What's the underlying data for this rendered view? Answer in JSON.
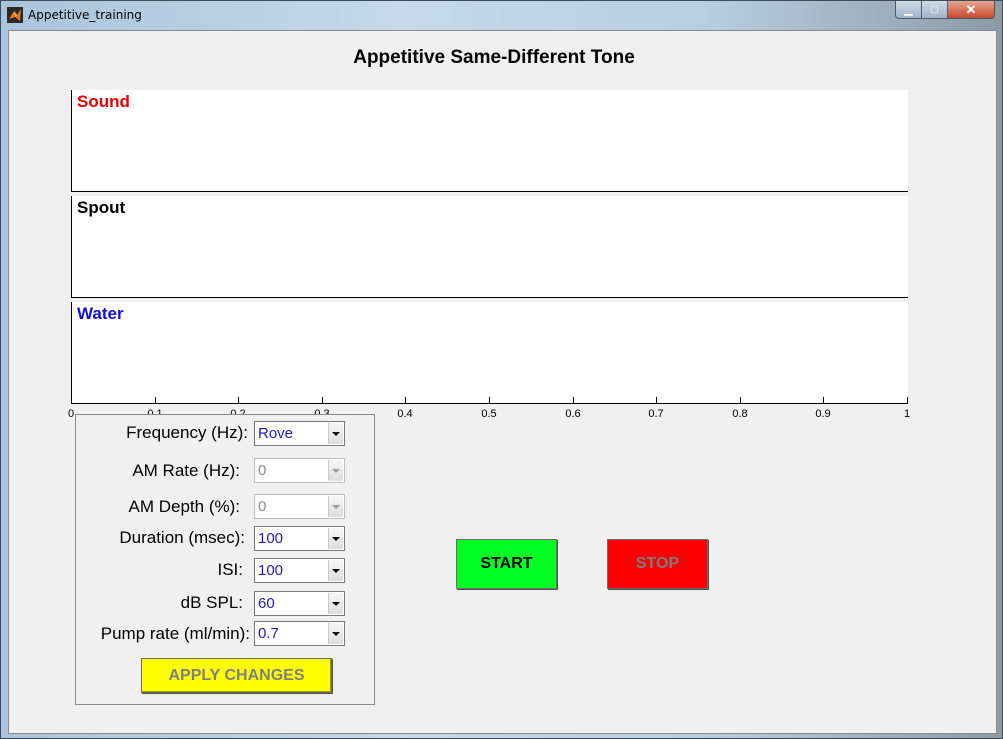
{
  "window": {
    "title": "Appetitive_training",
    "controls": {
      "minimize": "▁",
      "maximize": "□",
      "close": "✕"
    }
  },
  "main": {
    "title": "Appetitive Same-Different Tone",
    "plots": [
      {
        "label": "Sound",
        "color": "#e60000"
      },
      {
        "label": "Spout",
        "color": "#000000"
      },
      {
        "label": "Water",
        "color": "#1010d8"
      }
    ],
    "axis": {
      "ticks": [
        "0",
        "0.1",
        "0.2",
        "0.3",
        "0.4",
        "0.5",
        "0.6",
        "0.7",
        "0.8",
        "0.9",
        "1"
      ]
    }
  },
  "params": {
    "frequency": {
      "label": "Frequency (Hz):",
      "value": "Rove"
    },
    "am_rate": {
      "label": "AM Rate (Hz):",
      "value": "0"
    },
    "am_depth": {
      "label": "AM Depth (%):",
      "value": "0"
    },
    "duration": {
      "label": "Duration (msec):",
      "value": "100"
    },
    "isi": {
      "label": "ISI:",
      "value": "100"
    },
    "db_spl": {
      "label": "dB SPL:",
      "value": "60"
    },
    "pump_rate": {
      "label": "Pump rate (ml/min):",
      "value": "0.7"
    },
    "apply_label": "APPLY CHANGES"
  },
  "controls": {
    "start_label": "START",
    "stop_label": "STOP"
  },
  "colors": {
    "start": "#00ff22",
    "stop": "#ff0000",
    "apply": "#ffff00"
  }
}
